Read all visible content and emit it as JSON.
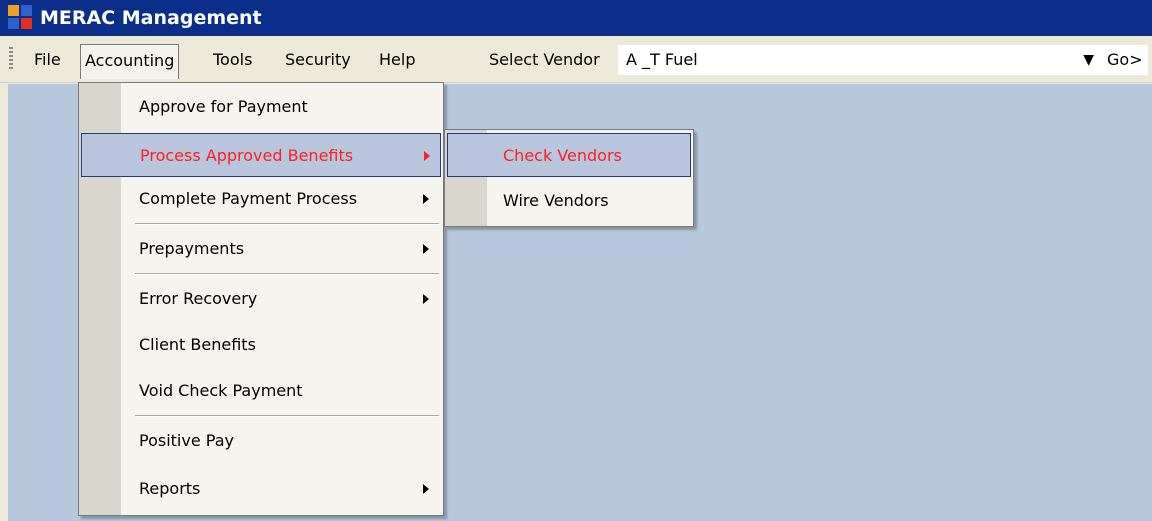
{
  "window": {
    "title": "MERAC Management",
    "icon": "app-icon"
  },
  "menubar": {
    "items": [
      "File",
      "Accounting",
      "Tools",
      "Security",
      "Help"
    ],
    "open_item": "Accounting"
  },
  "vendor": {
    "label": "Select Vendor",
    "value": "A _T Fuel",
    "go_label": "Go>"
  },
  "accounting_menu": {
    "items": [
      "Approve for Payment",
      "Process Approved Benefits",
      "Complete Payment Process",
      "Prepayments",
      "Error Recovery",
      "Client Benefits",
      "Void Check Payment",
      "Positive Pay",
      "Reports"
    ],
    "highlighted": "Process Approved Benefits"
  },
  "process_submenu": {
    "items": [
      "Check Vendors",
      "Wire Vendors"
    ],
    "highlighted": "Check Vendors"
  },
  "colors": {
    "titlebar": "#0a2e8a",
    "client_area": "#b7c7dd",
    "highlight_bg": "#b9c5dd",
    "highlight_text": "#ff2020"
  }
}
